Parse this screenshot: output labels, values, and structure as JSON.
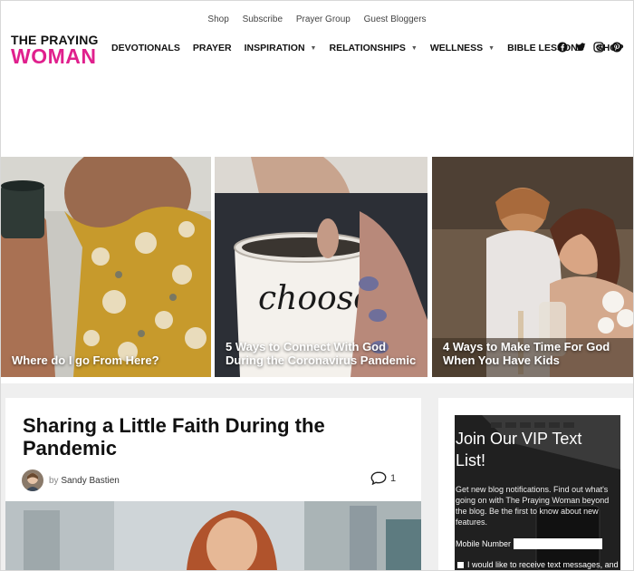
{
  "top_links": [
    "Shop",
    "Subscribe",
    "Prayer Group",
    "Guest Bloggers"
  ],
  "logo": {
    "line1": "THE PRAYING",
    "line2": "WOMAN"
  },
  "nav": [
    {
      "label": "DEVOTIONALS",
      "dropdown": false
    },
    {
      "label": "PRAYER",
      "dropdown": false
    },
    {
      "label": "INSPIRATION",
      "dropdown": true
    },
    {
      "label": "RELATIONSHIPS",
      "dropdown": true
    },
    {
      "label": "WELLNESS",
      "dropdown": true
    },
    {
      "label": "BIBLE LESSONS",
      "dropdown": false
    },
    {
      "label": "SHOP",
      "dropdown": false
    }
  ],
  "social": [
    "facebook-icon",
    "twitter-icon",
    "instagram-icon",
    "pinterest-icon"
  ],
  "hero": [
    {
      "caption": "Where do I go From Here?"
    },
    {
      "caption": "5 Ways to Connect With God During the Coronavirus Pandemic"
    },
    {
      "caption": "4 Ways to Make Time For God When You Have Kids"
    }
  ],
  "article": {
    "title": "Sharing a Little Faith During the Pandemic",
    "by": "by",
    "author": "Sandy Bastien",
    "comment_count": "1"
  },
  "sidebar": {
    "title": "Join Our VIP Text List!",
    "description": "Get new blog notifications. Find out what's going on with The Praying Woman beyond the blog. Be the first to know about new features.",
    "mobile_label": "Mobile Number",
    "checkbox_label": "I would like to receive text messages, and"
  },
  "colors": {
    "brand_pink": "#e0208d",
    "vip_bg": "#232323",
    "page_grey": "#efefef"
  }
}
